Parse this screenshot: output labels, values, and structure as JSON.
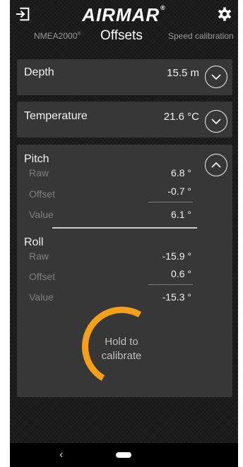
{
  "app": {
    "logo_text": "AIRMAR",
    "logo_mark": "®"
  },
  "tabs": {
    "left": "NMEA2000",
    "left_mark": "®",
    "center": "Offsets",
    "right": "Speed calibration"
  },
  "icons": {
    "exit": "exit-door-icon",
    "settings": "gear-icon",
    "expand": "chevron-down-circle-icon",
    "collapse": "chevron-up-circle-icon"
  },
  "depth": {
    "label": "Depth",
    "value": "15.5 m"
  },
  "temperature": {
    "label": "Temperature",
    "value": "21.6 °C"
  },
  "pitch": {
    "label": "Pitch",
    "raw_label": "Raw",
    "raw_value": "6.8 °",
    "offset_label": "Offset",
    "offset_value": "-0.7 °",
    "value_label": "Value",
    "value_value": "6.1 °"
  },
  "roll": {
    "label": "Roll",
    "raw_label": "Raw",
    "raw_value": "-15.9 °",
    "offset_label": "Offset",
    "offset_value": "0.6 °",
    "value_label": "Value",
    "value_value": "-15.3 °"
  },
  "calibrate": {
    "line1": "Hold to",
    "line2": "calibrate",
    "progress_fraction": 0.5,
    "color": "#f5a01a"
  },
  "navbar": {
    "back_glyph": "‹"
  },
  "colors": {
    "background": "#1c1c1c",
    "panel": "#3a3a3a",
    "accent": "#f5a01a",
    "text": "#f2f2f2",
    "muted": "#7f7f7f"
  }
}
